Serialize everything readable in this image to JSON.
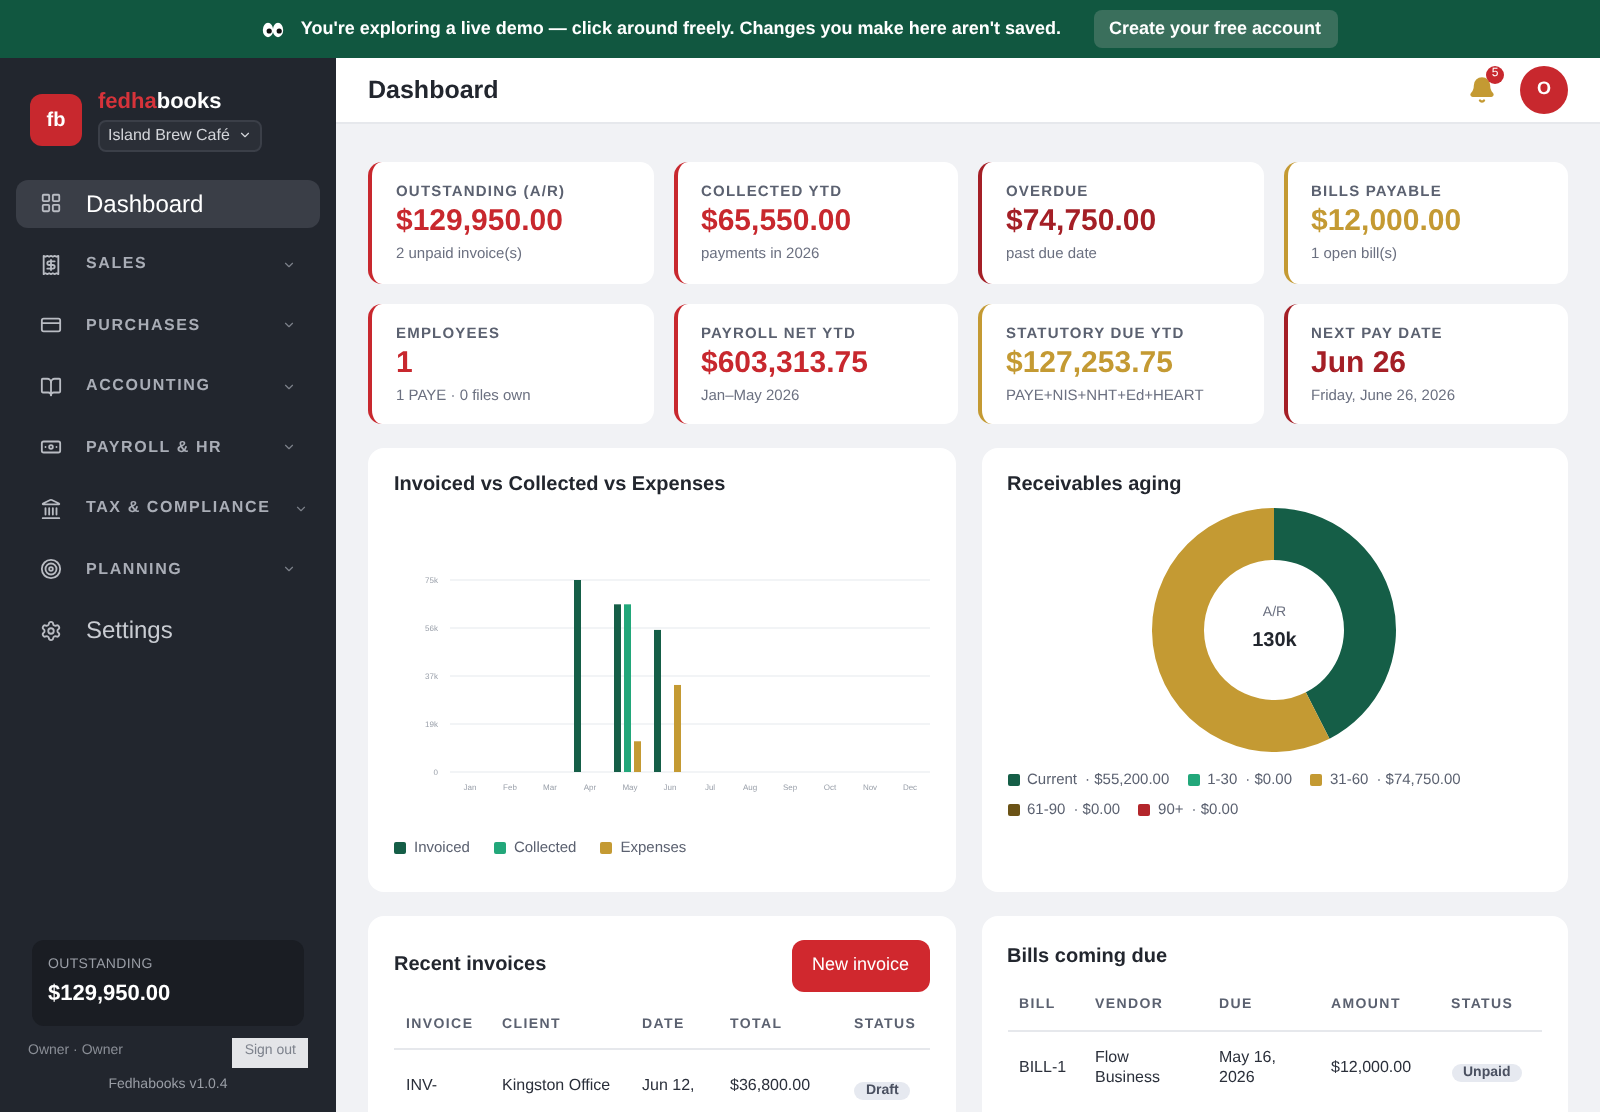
{
  "banner": {
    "message": "You're exploring a live demo — click around freely. Changes you make here aren't saved.",
    "button": "Create your free account"
  },
  "sidebar": {
    "brand_first": "fedha",
    "brand_second": "books",
    "logo": "fb",
    "company": "Island Brew Café",
    "items": [
      {
        "label": "Dashboard",
        "kind": "link",
        "selected": true
      },
      {
        "label": "SALES",
        "kind": "section",
        "selected": false
      },
      {
        "label": "PURCHASES",
        "kind": "section",
        "selected": false
      },
      {
        "label": "ACCOUNTING",
        "kind": "section",
        "selected": false
      },
      {
        "label": "PAYROLL & HR",
        "kind": "section",
        "selected": false
      },
      {
        "label": "TAX & COMPLIANCE",
        "kind": "section",
        "selected": false
      },
      {
        "label": "PLANNING",
        "kind": "section",
        "selected": false
      },
      {
        "label": "Settings",
        "kind": "link",
        "selected": false
      }
    ],
    "summary": {
      "label": "OUTSTANDING",
      "value": "$129,950.00"
    },
    "user": "Owner · Owner",
    "sign_out": {
      "label": "Sign out",
      "disabled": true
    },
    "version": "Fedhabooks v1.0.4"
  },
  "header": {
    "title": "Dashboard",
    "notifications": "5",
    "avatar": "O"
  },
  "kpis": [
    {
      "label": "OUTSTANDING (A/R)",
      "value": "$129,950.00",
      "note": "2 unpaid invoice(s)",
      "color": "#c8282e"
    },
    {
      "label": "COLLECTED YTD",
      "value": "$65,550.00",
      "note": "payments in 2026",
      "color": "#c8282e"
    },
    {
      "label": "OVERDUE",
      "value": "$74,750.00",
      "note": "past due date",
      "color": "#a41f26"
    },
    {
      "label": "BILLS PAYABLE",
      "value": "$12,000.00",
      "note": "1 open bill(s)",
      "color": "#c49a33"
    },
    {
      "label": "EMPLOYEES",
      "value": "1",
      "note": "1 PAYE · 0 files own",
      "color": "#c8282e"
    },
    {
      "label": "PAYROLL NET YTD",
      "value": "$603,313.75",
      "note": "Jan–May 2026",
      "color": "#c8282e"
    },
    {
      "label": "STATUTORY DUE YTD",
      "value": "$127,253.75",
      "note": "PAYE+NIS+NHT+Ed+HEART",
      "color": "#c49a33"
    },
    {
      "label": "NEXT PAY DATE",
      "value": "Jun 26",
      "note": "Friday, June 26, 2026",
      "color": "#a41f26"
    }
  ],
  "bar_chart": {
    "title": "Invoiced vs Collected vs Expenses",
    "chart_data": {
      "type": "bar",
      "categories": [
        "Jan",
        "Feb",
        "Mar",
        "Apr",
        "May",
        "Jun",
        "Jul",
        "Aug",
        "Sep",
        "Oct",
        "Nov",
        "Dec"
      ],
      "series": [
        {
          "name": "Invoiced",
          "color": "#155e47",
          "values": [
            0,
            0,
            0,
            75000,
            65500,
            55500,
            0,
            0,
            0,
            0,
            0,
            0
          ]
        },
        {
          "name": "Collected",
          "color": "#22a77a",
          "values": [
            0,
            0,
            0,
            0,
            65500,
            0,
            0,
            0,
            0,
            0,
            0,
            0
          ]
        },
        {
          "name": "Expenses",
          "color": "#c49a33",
          "values": [
            0,
            0,
            0,
            0,
            12000,
            34000,
            0,
            0,
            0,
            0,
            0,
            0
          ]
        }
      ],
      "ylim": [
        0,
        75000
      ],
      "grid": true,
      "yticks": [
        {
          "value": 0,
          "label": "0"
        },
        {
          "value": 18750,
          "label": "19k"
        },
        {
          "value": 37500,
          "label": "37k"
        },
        {
          "value": 56250,
          "label": "56k"
        },
        {
          "value": 75000,
          "label": "75k"
        }
      ]
    }
  },
  "aging": {
    "title": "Receivables aging",
    "center_label": "A/R",
    "center_value": "130k",
    "chart_data": {
      "type": "donut",
      "categories": [
        "Current",
        "1-30",
        "31-60",
        "61-90",
        "90+"
      ],
      "series": [
        {
          "values": [
            42.48,
            0,
            57.52,
            0,
            0
          ]
        }
      ]
    },
    "legend": [
      {
        "amount": "· $55,200.00",
        "color": "#155e47"
      },
      {
        "amount": "· $0.00",
        "color": "#22a77a"
      },
      {
        "amount": "· $74,750.00",
        "color": "#c49a33"
      },
      {
        "amount": "· $0.00",
        "color": "#6b5316"
      },
      {
        "amount": "· $0.00",
        "color": "#b3262b"
      }
    ]
  },
  "invoices": {
    "title": "Recent invoices",
    "button": "New invoice",
    "columns": [
      "INVOICE",
      "CLIENT",
      "DATE",
      "TOTAL",
      "STATUS"
    ],
    "rows": [
      {
        "cells": [
          "INV-",
          "Kingston Office",
          "Jun 12,",
          "$36,800.00"
        ],
        "status": "Draft"
      }
    ]
  },
  "bills": {
    "title": "Bills coming due",
    "columns": [
      "BILL",
      "VENDOR",
      "DUE",
      "AMOUNT",
      "STATUS"
    ],
    "rows": [
      {
        "cells": [
          "BILL-1",
          "Flow Business",
          "May 16, 2026",
          "$12,000.00"
        ],
        "status": "Unpaid"
      }
    ]
  }
}
